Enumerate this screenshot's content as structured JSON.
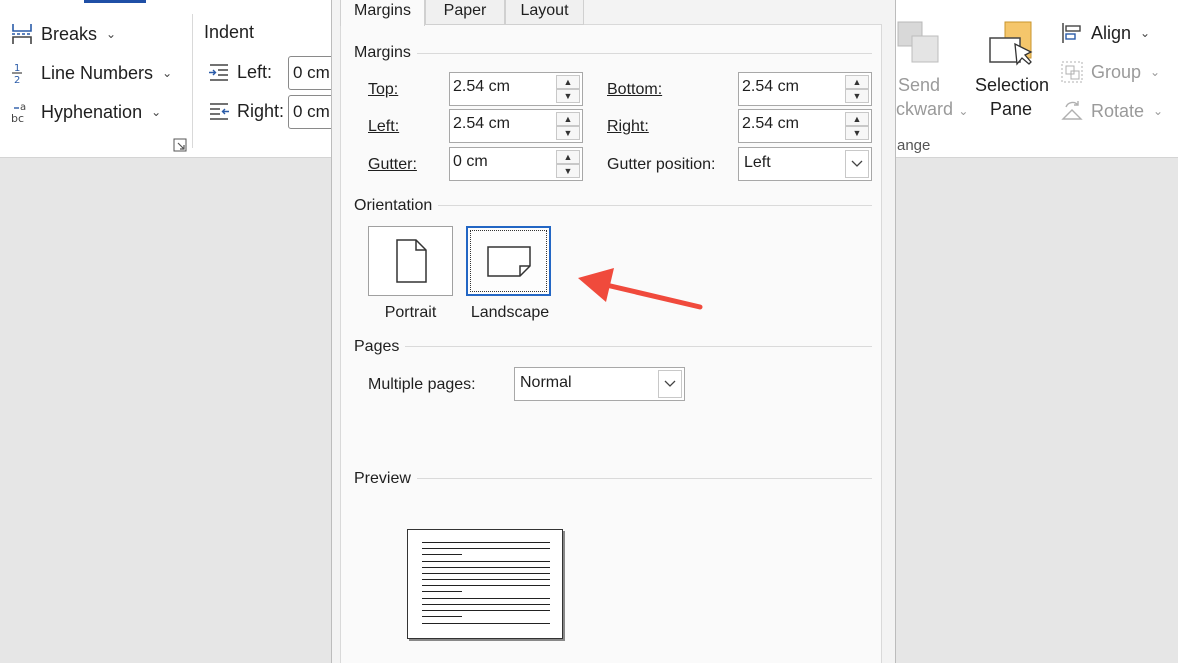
{
  "ribbon": {
    "page_setup": {
      "breaks": "Breaks",
      "line_numbers": "Line Numbers",
      "hyphenation": "Hyphenation"
    },
    "indent": {
      "title": "Indent",
      "left_label": "Left:",
      "left_value": "0 cm",
      "right_label": "Right:",
      "right_value": "0 cm"
    },
    "arrange": {
      "send_backward_line1": "Send",
      "send_backward_line2": "ckward",
      "group_label": "ange",
      "selection_pane_line1": "Selection",
      "selection_pane_line2": "Pane",
      "align": "Align",
      "group": "Group",
      "rotate": "Rotate"
    }
  },
  "dialog": {
    "tabs": [
      "Margins",
      "Paper",
      "Layout"
    ],
    "active_tab": "Margins",
    "margins": {
      "title": "Margins",
      "top_label": "Top:",
      "top_value": "2.54 cm",
      "bottom_label": "Bottom:",
      "bottom_value": "2.54 cm",
      "left_label": "Left:",
      "left_value": "2.54 cm",
      "right_label": "Right:",
      "right_value": "2.54 cm",
      "gutter_label": "Gutter:",
      "gutter_value": "0 cm",
      "gutter_position_label": "Gutter position:",
      "gutter_position_value": "Left"
    },
    "orientation": {
      "title": "Orientation",
      "portrait": "Portrait",
      "landscape": "Landscape",
      "selected": "Landscape"
    },
    "pages": {
      "title": "Pages",
      "multiple_pages_label": "Multiple pages:",
      "multiple_pages_value": "Normal"
    },
    "preview": {
      "title": "Preview"
    }
  },
  "colors": {
    "annotation_arrow": "#f04a3c",
    "selection_border": "#2266c4",
    "selection_pane_icon": "#f5c66b"
  },
  "icons": [
    "breaks-icon",
    "line-numbers-icon",
    "hyphenation-icon",
    "indent-left-icon",
    "indent-right-icon",
    "send-backward-icon",
    "selection-pane-icon",
    "align-icon",
    "group-icon",
    "rotate-icon",
    "portrait-page-icon",
    "landscape-page-icon"
  ]
}
